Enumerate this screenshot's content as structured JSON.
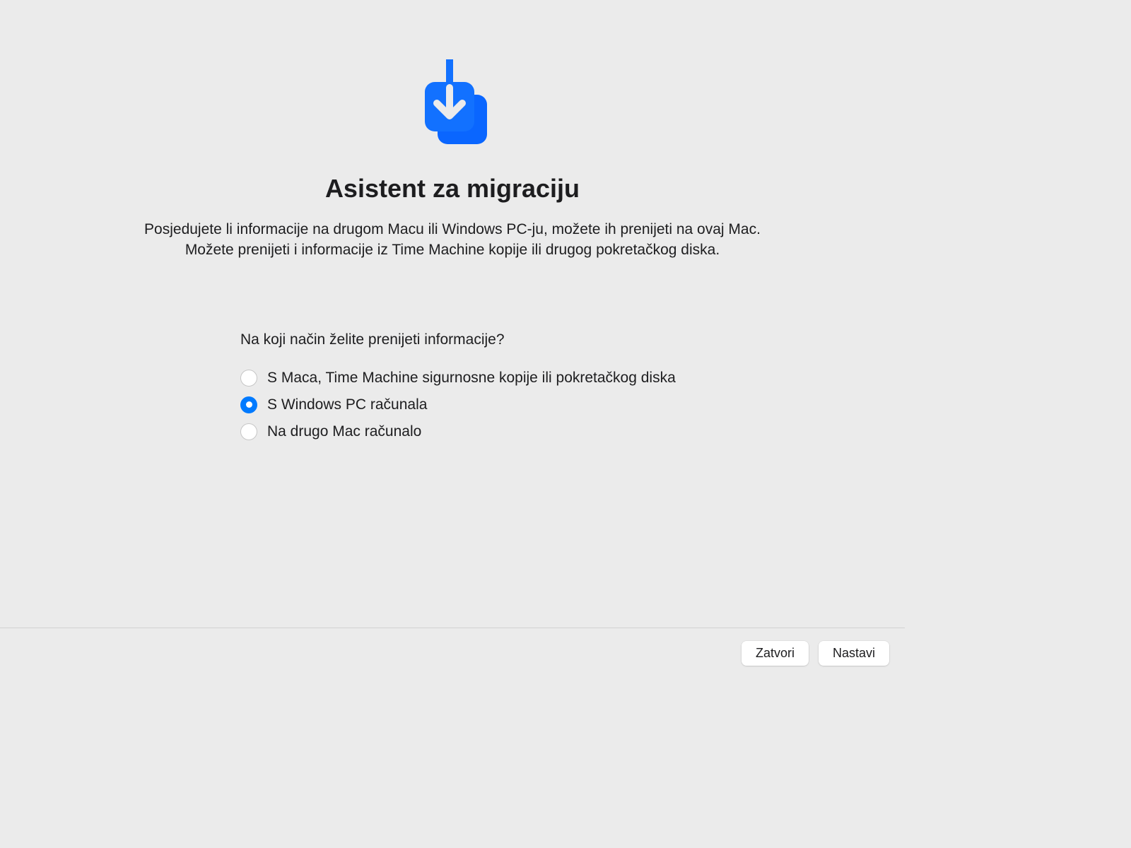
{
  "header": {
    "title": "Asistent za migraciju",
    "description": "Posjedujete li informacije na drugom Macu ili Windows PC-ju, možete ih prenijeti na ovaj Mac. Možete prenijeti i informacije iz Time Machine kopije ili drugog pokretačkog diska."
  },
  "form": {
    "question": "Na koji način želite prenijeti informacije?",
    "options": [
      {
        "label": "S Maca, Time Machine sigurnosne kopije ili pokretačkog diska",
        "selected": false
      },
      {
        "label": "S Windows PC računala",
        "selected": true
      },
      {
        "label": "Na drugo Mac računalo",
        "selected": false
      }
    ]
  },
  "footer": {
    "close_label": "Zatvori",
    "continue_label": "Nastavi"
  },
  "colors": {
    "accent": "#007AFF"
  }
}
